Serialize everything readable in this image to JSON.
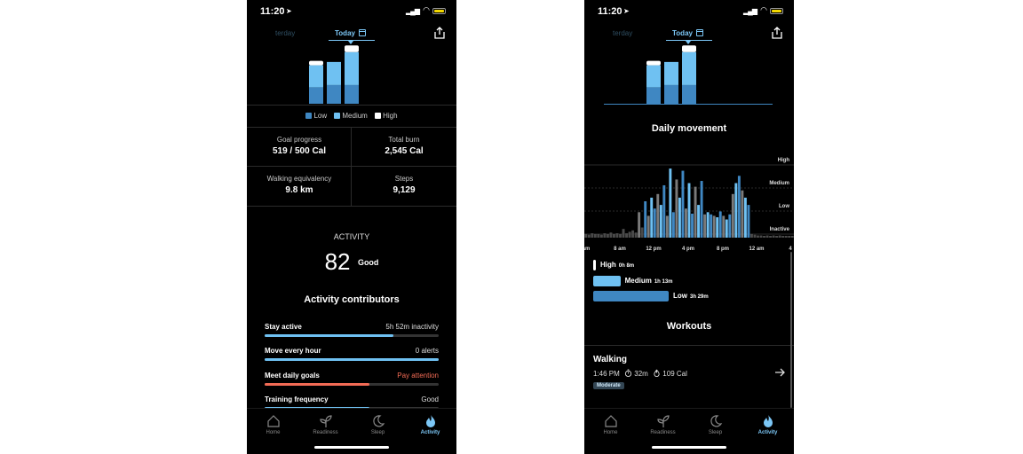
{
  "status": {
    "time": "11:20"
  },
  "colors": {
    "accent": "#7cc7f6",
    "low": "#3f87c2",
    "medium": "#6fc1f2",
    "high": "#ffffff",
    "warn": "#f26b55"
  },
  "day_tabs": {
    "yesterday": "terday",
    "today": "Today"
  },
  "day_bars": [
    {
      "low": 0.3,
      "medium": 0.4,
      "high": 0.08
    },
    {
      "low": 0.34,
      "medium": 0.42,
      "high": 0.0
    },
    {
      "low": 0.34,
      "medium": 0.6,
      "high": 0.12
    }
  ],
  "legend": [
    {
      "label": "Low",
      "color": "#3f87c2"
    },
    {
      "label": "Medium",
      "color": "#6fc1f2"
    },
    {
      "label": "High",
      "color": "#ffffff"
    }
  ],
  "metrics": {
    "goal_progress": {
      "label": "Goal progress",
      "value": "519 / 500 Cal"
    },
    "total_burn": {
      "label": "Total burn",
      "value": "2,545 Cal"
    },
    "walking": {
      "label": "Walking equivalency",
      "value": "9.8 km"
    },
    "steps": {
      "label": "Steps",
      "value": "9,129"
    }
  },
  "activity": {
    "label": "ACTIVITY",
    "score": "82",
    "rating": "Good"
  },
  "contributors_title": "Activity contributors",
  "contributors": [
    {
      "name": "Stay active",
      "status": "5h 52m inactivity",
      "progress": 0.74,
      "color": "#6fc1f2",
      "status_color": "#dddddd"
    },
    {
      "name": "Move every hour",
      "status": "0 alerts",
      "progress": 1.0,
      "color": "#6fc1f2",
      "status_color": "#dddddd"
    },
    {
      "name": "Meet daily goals",
      "status": "Pay attention",
      "progress": 0.6,
      "color": "#f26b55",
      "status_color": "#f26b55"
    },
    {
      "name": "Training frequency",
      "status": "Good",
      "progress": 0.6,
      "color": "#6fc1f2",
      "status_color": "#dddddd"
    }
  ],
  "tabs": [
    {
      "label": "Home",
      "icon": "home-icon"
    },
    {
      "label": "Readiness",
      "icon": "sprout-icon"
    },
    {
      "label": "Sleep",
      "icon": "moon-icon"
    },
    {
      "label": "Activity",
      "icon": "flame-icon",
      "active": true
    }
  ],
  "daily_movement": {
    "title": "Daily movement",
    "levels": [
      "High",
      "Medium",
      "Low",
      "Inactive"
    ],
    "time_labels": [
      "am",
      "8 am",
      "12 pm",
      "4 pm",
      "8 pm",
      "12 am",
      "4"
    ],
    "values": [
      0.05,
      0.04,
      0.06,
      0.05,
      0.05,
      0.04,
      0.06,
      0.05,
      0.07,
      0.05,
      0.06,
      0.05,
      0.12,
      0.06,
      0.08,
      0.1,
      0.07,
      0.35,
      0.14,
      0.5,
      0.3,
      0.55,
      0.4,
      0.6,
      0.45,
      0.72,
      0.3,
      0.95,
      0.35,
      0.8,
      0.55,
      0.92,
      0.4,
      0.75,
      0.33,
      0.7,
      0.45,
      0.78,
      0.32,
      0.35,
      0.32,
      0.3,
      0.28,
      0.36,
      0.3,
      0.25,
      0.32,
      0.6,
      0.75,
      0.85,
      0.65,
      0.55,
      0.45,
      0.05,
      0.04,
      0.03,
      0.03,
      0.02,
      0.03,
      0.02,
      0.03,
      0.02,
      0.03,
      0.02,
      0.02,
      0.02,
      0.02
    ]
  },
  "durations": [
    {
      "name": "High",
      "time": "0h 8m",
      "fraction": 0.03,
      "color": "#ffffff"
    },
    {
      "name": "Medium",
      "time": "1h 13m",
      "fraction": 0.36,
      "color": "#6fc1f2"
    },
    {
      "name": "Low",
      "time": "3h 29m",
      "fraction": 1.0,
      "color": "#3f87c2"
    }
  ],
  "workouts": {
    "title": "Workouts",
    "item": {
      "name": "Walking",
      "time": "1:46 PM",
      "duration": "32m",
      "calories": "109 Cal",
      "intensity": "Moderate"
    }
  }
}
